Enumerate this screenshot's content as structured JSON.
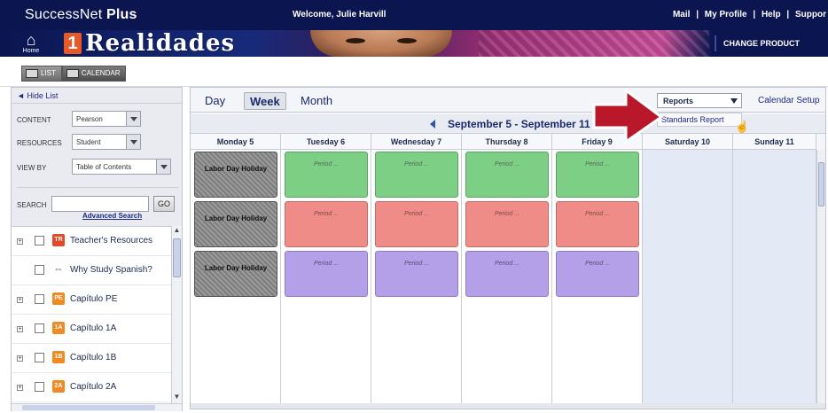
{
  "header": {
    "brand_prefix": "SuccessNet",
    "brand_suffix": "Plus",
    "welcome": "Welcome, Julie Harvill",
    "links": [
      "Mail",
      "|",
      "My Profile",
      "|",
      "Help",
      "|",
      "Suppor"
    ]
  },
  "banner": {
    "home_label": "Home",
    "logo_number": "1",
    "logo_text": "Realidades",
    "change_product": "CHANGE PRODUCT"
  },
  "view_toggle": {
    "list_label": "LIST",
    "calendar_label": "CALENDAR"
  },
  "sidebar": {
    "hide_list": "◄ Hide List",
    "filters": [
      {
        "label": "CONTENT",
        "value": "Pearson"
      },
      {
        "label": "RESOURCES",
        "value": "Student"
      },
      {
        "label": "VIEW BY",
        "value": "Table of Contents"
      }
    ],
    "search_label": "SEARCH",
    "search_value": "",
    "go_label": "GO",
    "advanced_search": "Advanced Search",
    "tree": [
      {
        "label": "Teacher's Resources",
        "icon": "TR",
        "color": "#e04a2a",
        "expandable": true
      },
      {
        "label": "Why Study Spanish?",
        "icon": "⇔",
        "color": "#8a8f99",
        "expandable": false
      },
      {
        "label": "Capítulo PE",
        "icon": "PE",
        "color": "#f08a24",
        "expandable": true
      },
      {
        "label": "Capítulo 1A",
        "icon": "1A",
        "color": "#f08a24",
        "expandable": true
      },
      {
        "label": "Capítulo 1B",
        "icon": "1B",
        "color": "#f08a24",
        "expandable": true
      },
      {
        "label": "Capítulo 2A",
        "icon": "2A",
        "color": "#f08a24",
        "expandable": true
      }
    ]
  },
  "calendar": {
    "tabs": [
      "Day",
      "Week",
      "Month"
    ],
    "active_tab": "Week",
    "reports_label": "Reports",
    "calendar_setup": "Calendar Setup",
    "dropdown_item": "Standards Report",
    "range": "September 5 - September 11",
    "days": [
      {
        "label": "Monday 5",
        "weekend": false
      },
      {
        "label": "Tuesday 6",
        "weekend": false
      },
      {
        "label": "Wednesday 7",
        "weekend": false
      },
      {
        "label": "Thursday 8",
        "weekend": false
      },
      {
        "label": "Friday 9",
        "weekend": false
      },
      {
        "label": "Saturday 10",
        "weekend": true
      },
      {
        "label": "Sunday 11",
        "weekend": true
      }
    ],
    "holiday_label": "Labor Day Holiday",
    "period_label": "Period ...",
    "colors": {
      "green": "#7ccf84",
      "red": "#f08c88",
      "purple": "#b4a0e8",
      "holiday": "#8a8a8a",
      "arrow": "#b8182a"
    }
  }
}
